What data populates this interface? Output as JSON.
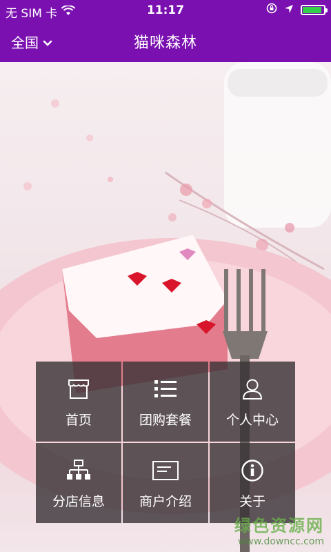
{
  "status_bar": {
    "carrier": "无 SIM 卡",
    "time": "11:17",
    "battery_level": 0.9
  },
  "nav": {
    "city": "全国",
    "title": "猫咪森林"
  },
  "menu": {
    "items": [
      {
        "label": "首页",
        "icon": "store-icon"
      },
      {
        "label": "团购套餐",
        "icon": "list-icon"
      },
      {
        "label": "个人中心",
        "icon": "user-icon"
      },
      {
        "label": "分店信息",
        "icon": "sitemap-icon"
      },
      {
        "label": "商户介绍",
        "icon": "card-icon"
      },
      {
        "label": "关于",
        "icon": "info-icon"
      }
    ]
  },
  "watermark": {
    "text": "绿色资源网",
    "url": "www.downcc.com"
  },
  "colors": {
    "nav_purple": "#7a10b0",
    "tile_dark": "#3a3438",
    "battery_green": "#35d04a"
  }
}
